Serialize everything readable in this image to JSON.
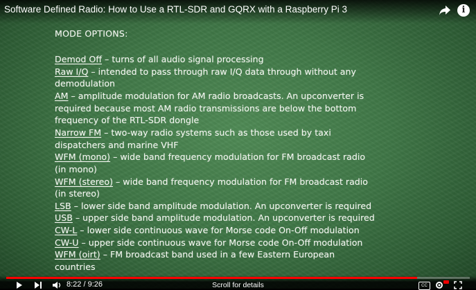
{
  "video": {
    "title": "Software Defined Radio: How to Use a RTL-SDR and GQRX with a Raspberry Pi 3",
    "time": "8:22 / 9:26",
    "scroll_hint": "Scroll for details",
    "progress": 0.887
  },
  "board": {
    "heading": "MODE OPTIONS:",
    "lines": [
      {
        "term": "Demod Off",
        "rest": " – turns of all audio signal processing"
      },
      {
        "term": "Raw I/Q",
        "rest": " – intended to pass through raw I/Q data through without any"
      },
      {
        "term": "",
        "rest": "demodulation"
      },
      {
        "term": "AM",
        "rest": " – amplitude modulation for AM radio broadcasts. An upconverter is"
      },
      {
        "term": "",
        "rest": "required because most AM radio transmissions are below the bottom"
      },
      {
        "term": "",
        "rest": "frequency of the RTL-SDR dongle"
      },
      {
        "term": "Narrow FM",
        "rest": " – two-way radio systems such as those used by taxi"
      },
      {
        "term": "",
        "rest": "dispatchers and marine VHF"
      },
      {
        "term": "WFM (mono)",
        "rest": " – wide band frequency modulation for FM broadcast radio"
      },
      {
        "term": "",
        "rest": "(in mono)"
      },
      {
        "term": "WFM (stereo)",
        "rest": " – wide band frequency modulation for FM broadcast radio"
      },
      {
        "term": "",
        "rest": "(in stereo)"
      },
      {
        "term": "LSB",
        "rest": " – lower side band amplitude modulation.  An upconverter is required"
      },
      {
        "term": "USB",
        "rest": " – upper side band amplitude modulation.  An upconverter is required"
      },
      {
        "term": "CW-L",
        "rest": " – lower side continuous wave for Morse code On-Off modulation"
      },
      {
        "term": "CW-U",
        "rest": " – upper side continuous wave for Morse code On-Off modulation"
      },
      {
        "term": "WFM (oirt)",
        "rest": " – FM broadcast band used in a few Eastern European"
      },
      {
        "term": "",
        "rest": "countries"
      }
    ]
  },
  "colors": {
    "progress": "#ff0000",
    "chalk": "#f3f6f0",
    "board": "#3f7646"
  },
  "icons": [
    "share-icon",
    "info-icon",
    "play-icon",
    "next-icon",
    "volume-icon",
    "captions-icon",
    "settings-icon",
    "fullscreen-icon"
  ]
}
